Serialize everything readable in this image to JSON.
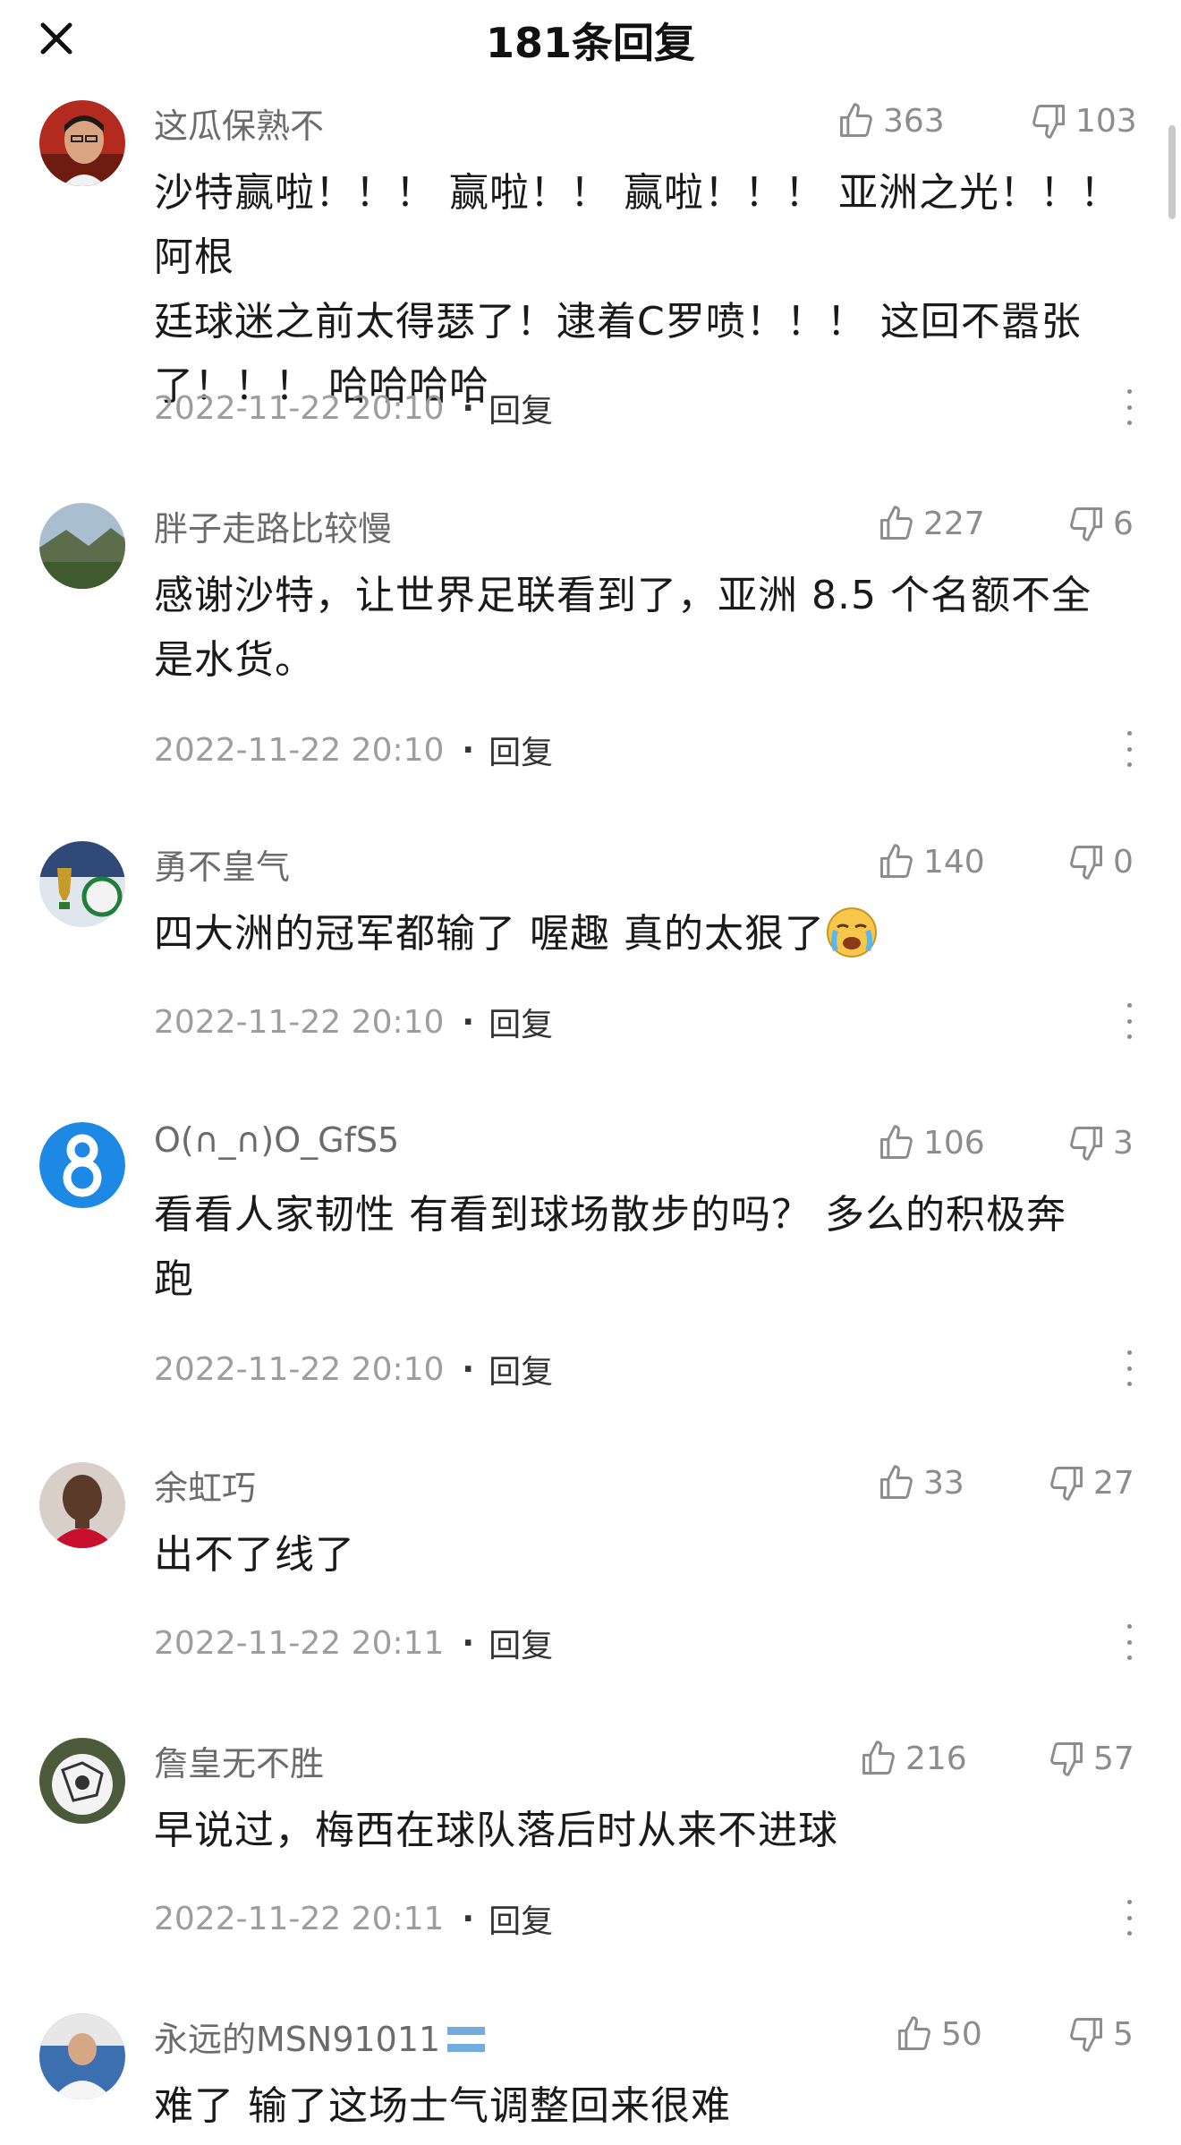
{
  "header": {
    "title": "181条回复",
    "close_icon": "close-icon"
  },
  "comments": [
    {
      "username": "这瓜保熟不",
      "likes": "363",
      "dislikes": "103",
      "lines": [
        "沙特赢啦！！！ 赢啦！！ 赢啦！！！ 亚洲之光！！！ 阿根",
        "廷球迷之前太得瑟了！逮着C罗喷！！！ 这回不嚣张",
        "了！！！ 哈哈哈哈"
      ],
      "time": "2022-11-22 20:10",
      "reply": "回复"
    },
    {
      "username": "胖子走路比较慢",
      "likes": "227",
      "dislikes": "6",
      "lines": [
        "感谢沙特，让世界足联看到了，亚洲 8.5 个名额不全",
        "是水货。"
      ],
      "time": "2022-11-22 20:10",
      "reply": "回复"
    },
    {
      "username": "勇不皇气",
      "likes": "140",
      "dislikes": "0",
      "lines": [
        "四大洲的冠军都输了 喔趣 真的太狠了"
      ],
      "emoji": "crying-emoji-icon",
      "time": "2022-11-22 20:10",
      "reply": "回复"
    },
    {
      "username": "O(∩_∩)O_GfS5",
      "likes": "106",
      "dislikes": "3",
      "lines": [
        "看看人家韧性 有看到球场散步的吗？ 多么的积极奔",
        "跑"
      ],
      "time": "2022-11-22 20:10",
      "reply": "回复"
    },
    {
      "username": "余虹巧",
      "likes": "33",
      "dislikes": "27",
      "lines": [
        "出不了线了"
      ],
      "time": "2022-11-22 20:11",
      "reply": "回复"
    },
    {
      "username": "詹皇无不胜",
      "likes": "216",
      "dislikes": "57",
      "lines": [
        "早说过，梅西在球队落后时从来不进球"
      ],
      "time": "2022-11-22 20:11",
      "reply": "回复"
    },
    {
      "username": "永远的MSN91011",
      "likes": "50",
      "dislikes": "5",
      "lines": [
        "难了 输了这场士气调整回来很难"
      ],
      "time": "",
      "reply": ""
    }
  ]
}
